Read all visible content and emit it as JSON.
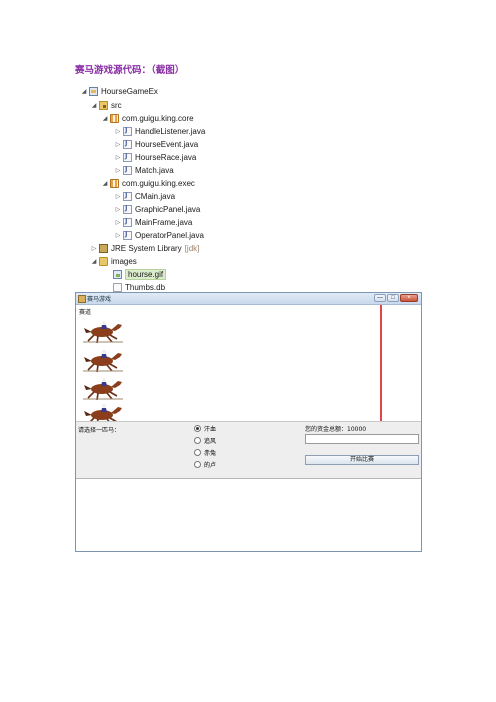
{
  "heading": "赛马游戏源代码：（截图）",
  "tree": {
    "project": "HourseGameEx",
    "src": "src",
    "package_core": "com.guigu.king.core",
    "core_files": [
      "HandleListener.java",
      "HourseEvent.java",
      "HourseRace.java",
      "Match.java"
    ],
    "package_exec": "com.guigu.king.exec",
    "exec_files": [
      "CMain.java",
      "GraphicPanel.java",
      "MainFrame.java",
      "OperatorPanel.java"
    ],
    "jre_library": "JRE System Library",
    "jre_tag": "[jdk]",
    "images_folder": "images",
    "images_files": [
      "hourse.gif",
      "Thumbs.db"
    ]
  },
  "game_window": {
    "title": "赛马游戏",
    "track_label": "赛道",
    "choose_label": "请选择一匹马：",
    "horses": [
      "汗血",
      "追风",
      "赤兔",
      "的卢"
    ],
    "selected_horse": "汗血",
    "balance_label": "您的资金总额：10000",
    "bet_value": "",
    "start_button": "开始比赛",
    "window_buttons": [
      "—",
      "□",
      "×"
    ]
  },
  "colors": {
    "heading": "#8b2fa6",
    "finish_line": "#e04646",
    "horse_body": "#8a3e1c",
    "jockey": "#3a3a8c"
  }
}
